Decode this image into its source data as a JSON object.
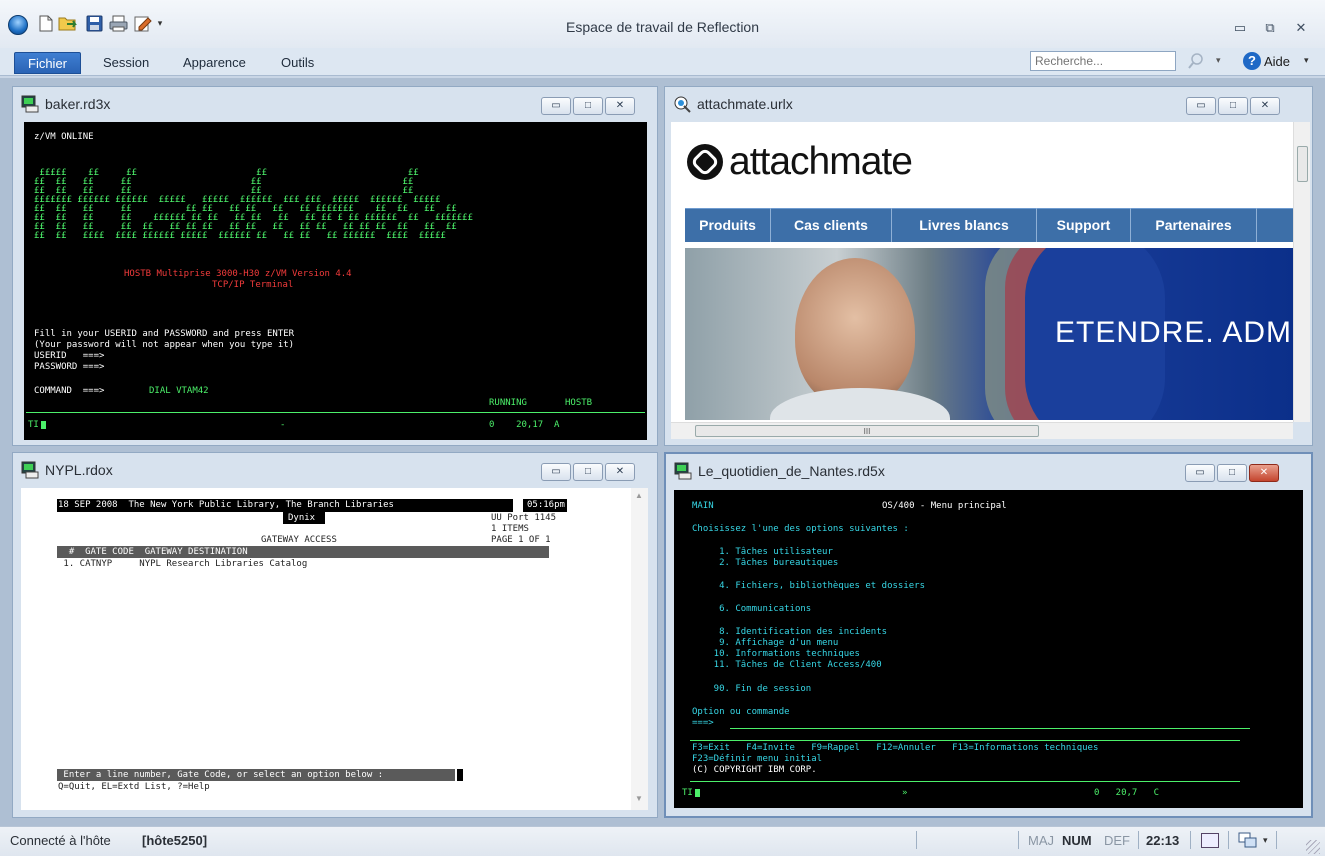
{
  "app": {
    "title": "Espace de travail de Reflection",
    "accent": "#2a63b5"
  },
  "quick_access": {
    "icons": [
      "new-document-icon",
      "open-icon",
      "save-icon",
      "print-icon",
      "edit-icon",
      "dropdown-arrow-icon"
    ]
  },
  "window_controls": {
    "minimize": "▭",
    "restore": "⧉",
    "close": "✕"
  },
  "ribbon": {
    "tabs": [
      {
        "label": "Fichier",
        "active": true
      },
      {
        "label": "Session",
        "active": false
      },
      {
        "label": "Apparence",
        "active": false
      },
      {
        "label": "Outils",
        "active": false
      }
    ],
    "search_placeholder": "Recherche...",
    "help_label": "Aide"
  },
  "panes": {
    "baker": {
      "title": "baker.rd3x",
      "zvm_online": "z/VM ONLINE",
      "logo_lines": [
        " £££££    ££     ££                      ££                          ££",
        "££  ££   ££     ££                      ££                          ££",
        "££  ££   ££     ££                      ££                          ££",
        "£££££££ ££££££ ££££££  £££££   £££££  ££££££  £££ £££  £££££  ££££££  £££££",
        "££  ££   ££     ££          ££ ££   ££ ££   ££   ££ £££££££    ££  ££   ££  ££",
        "££  ££   ££     ££    ££££££ ££ ££   ££ ££   ££   ££ ££ £ ££ ££££££  ££   £££££££",
        "££  ££   ££     ££  ££   ££ ££ ££   ££ ££   ££   ££ ££   ££ ££ ££  ££   ££  ££",
        "££  ££   ££££  ££££ ££££££ £££££  ££££££ ££   ££ ££   ££ ££££££  ££££  £££££"
      ],
      "system_line": "HOSTB Multiprise 3000-H30 z/VM Version 4.4",
      "tcpip": "TCP/IP Terminal",
      "prompt1": "Fill in your USERID and PASSWORD and press ENTER",
      "prompt2": "(Your password will not appear when you type it)",
      "userid": "USERID   ===>",
      "password": "PASSWORD ===>",
      "command": "COMMAND  ===>",
      "command_value": "DIAL VTAM42",
      "status_running": "RUNNING",
      "status_host": "HOSTB",
      "oia_left": "TI",
      "oia_mid": "-",
      "oia_right": "0    20,17  A"
    },
    "attachmate": {
      "title": "attachmate.urlx",
      "brand": "attachmate",
      "nav": [
        "Produits",
        "Cas clients",
        "Livres blancs",
        "Support",
        "Partenaires"
      ],
      "banner_text": "ETENDRE. ADM",
      "scroll_mark": "III"
    },
    "nypl": {
      "title": "NYPL.rdox",
      "header_line": "18 SEP 2008  The New York Public Library, The Branch Libraries",
      "time": "05:16pm",
      "dynix": "Dynix",
      "port": "UU Port 1145",
      "items": "1 ITEMS",
      "gateway": "GATEWAY ACCESS",
      "page": "PAGE 1 OF 1",
      "col_header": "  #  GATE CODE  GATEWAY DESTINATION",
      "row": " 1. CATNYP     NYPL Research Libraries Catalog",
      "prompt": " Enter a line number, Gate Code, or select an option below :",
      "options": "Q=Quit, EL=Extd List, ?=Help"
    },
    "nantes": {
      "title": "Le_quotidien_de_Nantes.rd5x",
      "main": "MAIN",
      "heading": "OS/400 - Menu principal",
      "choose": "Choisissez l'une des options suivantes :",
      "menu": [
        "     1. Tâches utilisateur",
        "     2. Tâches bureautiques",
        "",
        "     4. Fichiers, bibliothèques et dossiers",
        "",
        "     6. Communications",
        "",
        "     8. Identification des incidents",
        "     9. Affichage d'un menu",
        "    10. Informations techniques",
        "    11. Tâches de Client Access/400",
        "",
        "    90. Fin de session"
      ],
      "option_label": "Option ou commande",
      "cmd_prompt": "===>",
      "fkeys1": "F3=Exit   F4=Invite   F9=Rappel   F12=Annuler   F13=Informations techniques",
      "fkeys2": "F23=Définir menu initial",
      "copyright": "(C) COPYRIGHT IBM CORP.",
      "oia_left": "TI",
      "oia_mid": "»",
      "oia_right": "0   20,7   C"
    }
  },
  "status": {
    "connected": "Connecté à l'hôte",
    "host": "[hôte5250]",
    "maj": "MAJ",
    "num": "NUM",
    "def": "DEF",
    "clock": "22:13"
  }
}
